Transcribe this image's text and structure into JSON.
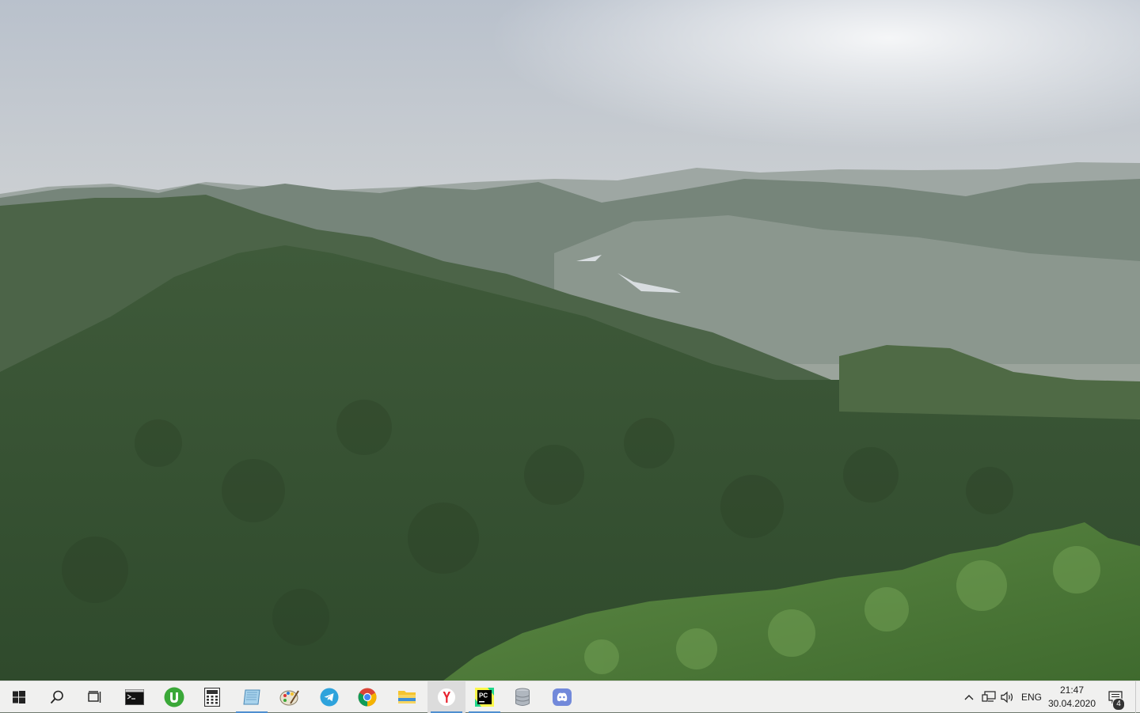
{
  "desktop": {
    "wallpaper": "mountain-forest-landscape"
  },
  "taskbar": {
    "start": {
      "icon": "windows-logo-icon"
    },
    "search": {
      "icon": "search-icon"
    },
    "task_view": {
      "icon": "task-view-icon"
    },
    "pinned_apps": [
      {
        "name": "terminal",
        "icon": "terminal-icon",
        "state": "normal"
      },
      {
        "name": "utorrent",
        "icon": "utorrent-icon",
        "state": "normal"
      },
      {
        "name": "calculator",
        "icon": "calculator-icon",
        "state": "normal"
      },
      {
        "name": "notes",
        "icon": "notes-app-icon",
        "state": "active"
      },
      {
        "name": "paint",
        "icon": "paint-palette-icon",
        "state": "normal"
      },
      {
        "name": "telegram",
        "icon": "telegram-icon",
        "state": "normal"
      },
      {
        "name": "chrome",
        "icon": "chrome-icon",
        "state": "normal"
      },
      {
        "name": "file-explorer",
        "icon": "folder-icon",
        "state": "normal"
      },
      {
        "name": "yandex-browser",
        "icon": "yandex-browser-icon",
        "state": "focused"
      },
      {
        "name": "pycharm",
        "icon": "pycharm-icon",
        "state": "active"
      },
      {
        "name": "database",
        "icon": "database-icon",
        "state": "normal"
      },
      {
        "name": "discord",
        "icon": "discord-icon",
        "state": "normal"
      }
    ],
    "tray": {
      "chevron": "chevron-up-icon",
      "network": "network-icon",
      "volume": "volume-icon",
      "language": "ENG",
      "time": "21:47",
      "date": "30.04.2020",
      "notifications_count": "4"
    }
  },
  "colors": {
    "taskbar_bg": "#f0f0ef",
    "accent": "#4f8fd0"
  }
}
